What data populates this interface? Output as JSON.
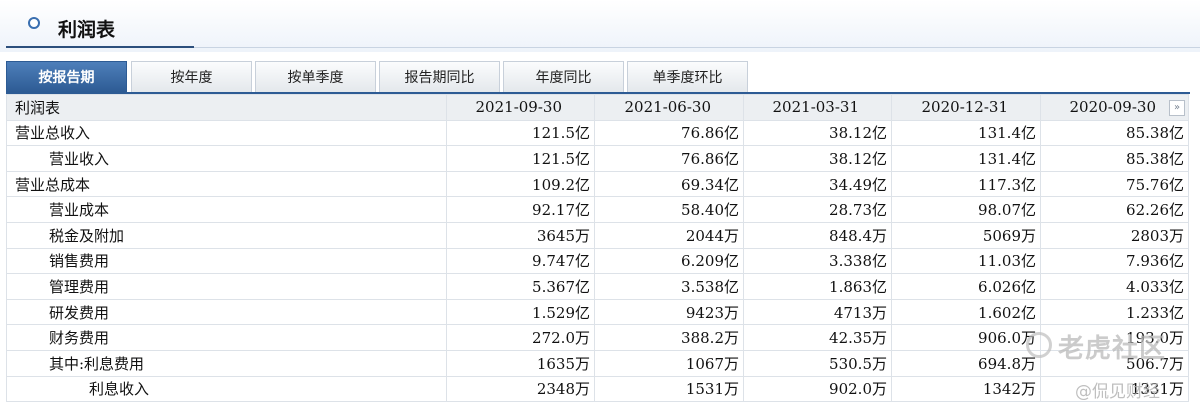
{
  "title": "利润表",
  "tabs": [
    "按报告期",
    "按年度",
    "按单季度",
    "报告期同比",
    "年度同比",
    "单季度环比"
  ],
  "active_tab": 0,
  "table": {
    "header": [
      "利润表",
      "2021-09-30",
      "2021-06-30",
      "2021-03-31",
      "2020-12-31",
      "2020-09-30"
    ],
    "more_label": "»",
    "rows": [
      {
        "label": "营业总收入",
        "level": 0,
        "values": [
          "121.5亿",
          "76.86亿",
          "38.12亿",
          "131.4亿",
          "85.38亿"
        ]
      },
      {
        "label": "营业收入",
        "level": 1,
        "values": [
          "121.5亿",
          "76.86亿",
          "38.12亿",
          "131.4亿",
          "85.38亿"
        ]
      },
      {
        "label": "营业总成本",
        "level": 0,
        "values": [
          "109.2亿",
          "69.34亿",
          "34.49亿",
          "117.3亿",
          "75.76亿"
        ]
      },
      {
        "label": "营业成本",
        "level": 1,
        "values": [
          "92.17亿",
          "58.40亿",
          "28.73亿",
          "98.07亿",
          "62.26亿"
        ]
      },
      {
        "label": "税金及附加",
        "level": 1,
        "values": [
          "3645万",
          "2044万",
          "848.4万",
          "5069万",
          "2803万"
        ]
      },
      {
        "label": "销售费用",
        "level": 1,
        "values": [
          "9.747亿",
          "6.209亿",
          "3.338亿",
          "11.03亿",
          "7.936亿"
        ]
      },
      {
        "label": "管理费用",
        "level": 1,
        "values": [
          "5.367亿",
          "3.538亿",
          "1.863亿",
          "6.026亿",
          "4.033亿"
        ]
      },
      {
        "label": "研发费用",
        "level": 1,
        "values": [
          "1.529亿",
          "9423万",
          "4713万",
          "1.602亿",
          "1.233亿"
        ]
      },
      {
        "label": "财务费用",
        "level": 1,
        "values": [
          "272.0万",
          "388.2万",
          "42.35万",
          "906.0万",
          "193.0万"
        ]
      },
      {
        "label": "其中:利息费用",
        "level": 1,
        "values": [
          "1635万",
          "1067万",
          "530.5万",
          "694.8万",
          "506.7万"
        ]
      },
      {
        "label": "利息收入",
        "level": 2,
        "values": [
          "2348万",
          "1531万",
          "902.0万",
          "1342万",
          "1331万"
        ]
      }
    ]
  },
  "watermarks": {
    "primary": "老虎社区",
    "secondary": "@侃见财经"
  }
}
